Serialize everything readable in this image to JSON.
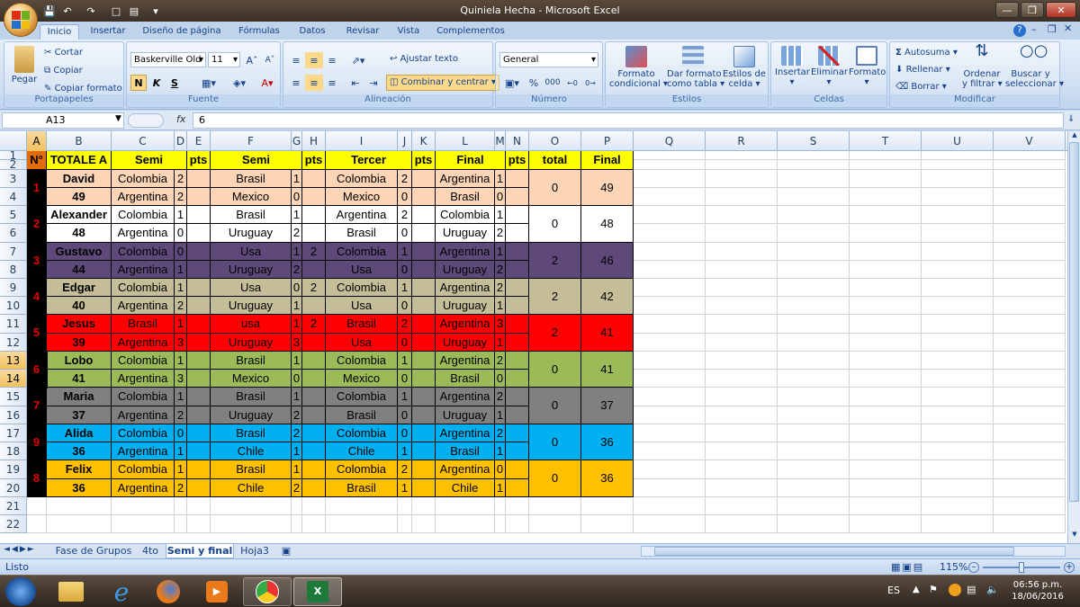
{
  "window": {
    "title": "Quiniela Hecha - Microsoft Excel"
  },
  "tabs": [
    "Inicio",
    "Insertar",
    "Diseño de página",
    "Fórmulas",
    "Datos",
    "Revisar",
    "Vista",
    "Complementos"
  ],
  "ribbon": {
    "portapapeles": {
      "paste": "Pegar",
      "cut": "Cortar",
      "copy": "Copiar",
      "format_painter": "Copiar formato",
      "label": "Portapapeles"
    },
    "fuente": {
      "font": "Baskerville Old",
      "size": "11",
      "bold": "N",
      "italic": "K",
      "underline": "S",
      "label": "Fuente"
    },
    "alineacion": {
      "wrap": "Ajustar texto",
      "merge": "Combinar y centrar",
      "label": "Alineación"
    },
    "numero": {
      "format": "General",
      "percent": "%",
      "thousands": "000",
      "label": "Número"
    },
    "estilos": {
      "conditional": [
        "Formato",
        "condicional"
      ],
      "table": [
        "Dar formato",
        "como tabla"
      ],
      "cellstyles": [
        "Estilos de",
        "celda"
      ],
      "label": "Estilos"
    },
    "celdas": {
      "insert": "Insertar",
      "delete": "Eliminar",
      "format": "Formato",
      "label": "Celdas"
    },
    "modificar": {
      "autosum": "Autosuma",
      "fill": "Rellenar",
      "clear": "Borrar",
      "sort": [
        "Ordenar",
        "y filtrar"
      ],
      "find": [
        "Buscar y",
        "seleccionar"
      ],
      "label": "Modificar"
    }
  },
  "formula_bar": {
    "name_box": "A13",
    "fx": "fx",
    "value": "6"
  },
  "columns": [
    "A",
    "B",
    "C",
    "D",
    "E",
    "F",
    "G",
    "H",
    "I",
    "J",
    "K",
    "L",
    "M",
    "N",
    "O",
    "P",
    "Q",
    "R",
    "S",
    "T",
    "U",
    "V"
  ],
  "rows": [
    "1",
    "2",
    "3",
    "4",
    "5",
    "6",
    "7",
    "8",
    "9",
    "10",
    "11",
    "12",
    "13",
    "14",
    "15",
    "16",
    "17",
    "18",
    "19",
    "20",
    "21",
    "22"
  ],
  "header": {
    "num": "N°",
    "name": "TOTALE A",
    "semi1": "Semi",
    "pts1": "pts",
    "semi2": "Semi",
    "pts2": "pts",
    "tercer": "Tercer",
    "pts3": "pts",
    "final": "Final",
    "pts4": "pts",
    "total": "total",
    "final_total": "Final"
  },
  "players": [
    {
      "rank": "1",
      "name": "David",
      "score": "49",
      "color": "#fbd5b5",
      "rows": [
        [
          "Colombia",
          "2",
          "",
          "Brasil",
          "1",
          "",
          "Colombia",
          "2",
          "",
          "Argentina",
          "1",
          ""
        ],
        [
          "Argentina",
          "2",
          "",
          "Mexico",
          "0",
          "",
          "Mexico",
          "0",
          "",
          "Brasil",
          "0",
          ""
        ]
      ],
      "total": "0",
      "final": "49"
    },
    {
      "rank": "2",
      "name": "Alexander",
      "score": "48",
      "color": "#ffffff",
      "rows": [
        [
          "Colombia",
          "1",
          "",
          "Brasil",
          "1",
          "",
          "Argentina",
          "2",
          "",
          "Colombia",
          "1",
          ""
        ],
        [
          "Argentina",
          "0",
          "",
          "Uruguay",
          "2",
          "",
          "Brasil",
          "0",
          "",
          "Uruguay",
          "2",
          ""
        ]
      ],
      "total": "0",
      "final": "48"
    },
    {
      "rank": "3",
      "name": "Gustavo",
      "score": "44",
      "color": "#5f497a",
      "rows": [
        [
          "Colombia",
          "0",
          "",
          "Usa",
          "1",
          "2",
          "Colombia",
          "1",
          "",
          "Argentina",
          "1",
          ""
        ],
        [
          "Argentina",
          "1",
          "",
          "Uruguay",
          "2",
          "",
          "Usa",
          "0",
          "",
          "Uruguay",
          "2",
          ""
        ]
      ],
      "total": "2",
      "final": "46"
    },
    {
      "rank": "4",
      "name": "Edgar",
      "score": "40",
      "color": "#c4bd97",
      "rows": [
        [
          "Colombia",
          "1",
          "",
          "Usa",
          "0",
          "2",
          "Colombia",
          "1",
          "",
          "Argentina",
          "2",
          ""
        ],
        [
          "Argentina",
          "2",
          "",
          "Uruguay",
          "1",
          "",
          "Usa",
          "0",
          "",
          "Uruguay",
          "1",
          ""
        ]
      ],
      "total": "2",
      "final": "42"
    },
    {
      "rank": "5",
      "name": "Jesus",
      "score": "39",
      "color": "#ff0000",
      "rows": [
        [
          "Brasil",
          "1",
          "",
          "usa",
          "1",
          "2",
          "Brasil",
          "2",
          "",
          "Argentina",
          "3",
          ""
        ],
        [
          "Argentina",
          "3",
          "",
          "Uruguay",
          "3",
          "",
          "Usa",
          "0",
          "",
          "Uruguay",
          "1",
          ""
        ]
      ],
      "total": "2",
      "final": "41"
    },
    {
      "rank": "6",
      "name": "Lobo",
      "score": "41",
      "color": "#9bbb59",
      "rows": [
        [
          "Colombia",
          "1",
          "",
          "Brasil",
          "1",
          "",
          "Colombia",
          "1",
          "",
          "Argentina",
          "2",
          ""
        ],
        [
          "Argentina",
          "3",
          "",
          "Mexico",
          "0",
          "",
          "Mexico",
          "0",
          "",
          "Brasil",
          "0",
          ""
        ]
      ],
      "total": "0",
      "final": "41"
    },
    {
      "rank": "7",
      "name": "Maria",
      "score": "37",
      "color": "#808080",
      "rows": [
        [
          "Colombia",
          "1",
          "",
          "Brasil",
          "1",
          "",
          "Colombia",
          "1",
          "",
          "Argentina",
          "2",
          ""
        ],
        [
          "Argentina",
          "2",
          "",
          "Uruguay",
          "2",
          "",
          "Brasil",
          "0",
          "",
          "Uruguay",
          "1",
          ""
        ]
      ],
      "total": "0",
      "final": "37"
    },
    {
      "rank": "9",
      "name": "Alida",
      "score": "36",
      "color": "#00b0f0",
      "rows": [
        [
          "Colombia",
          "0",
          "",
          "Brasil",
          "2",
          "",
          "Colombia",
          "0",
          "",
          "Argentina",
          "2",
          ""
        ],
        [
          "Argentina",
          "1",
          "",
          "Chile",
          "1",
          "",
          "Chile",
          "1",
          "",
          "Brasil",
          "1",
          ""
        ]
      ],
      "total": "0",
      "final": "36"
    },
    {
      "rank": "8",
      "name": "Felix",
      "score": "36",
      "color": "#ffc000",
      "rows": [
        [
          "Colombia",
          "1",
          "",
          "Brasil",
          "1",
          "",
          "Colombia",
          "2",
          "",
          "Argentina",
          "0",
          ""
        ],
        [
          "Argentina",
          "2",
          "",
          "Chile",
          "2",
          "",
          "Brasil",
          "1",
          "",
          "Chile",
          "1",
          ""
        ]
      ],
      "total": "0",
      "final": "36"
    }
  ],
  "sheet_tabs": [
    "Fase de Grupos",
    "4to",
    "Semi y final",
    "Hoja3"
  ],
  "active_sheet": "Semi y final",
  "status": {
    "text": "Listo",
    "zoom": "115%"
  },
  "taskbar": {
    "lang": "ES",
    "time": "06:56 p.m.",
    "date": "18/06/2016"
  }
}
